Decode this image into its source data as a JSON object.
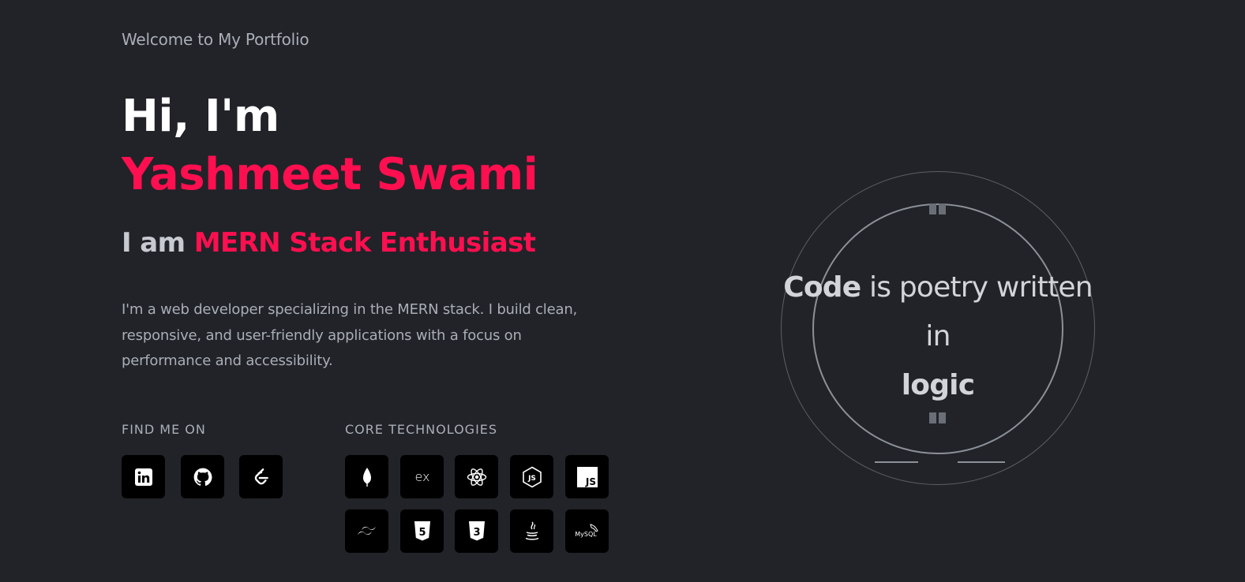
{
  "hero": {
    "welcome": "Welcome to My Portfolio",
    "greeting": "Hi, I'm",
    "name": "Yashmeet Swami",
    "role_prefix": "I am",
    "role": "MERN Stack Enthusiast",
    "bio": "I'm a web developer specializing in the MERN stack. I build clean, responsive, and user-friendly applications with a focus on performance and accessibility."
  },
  "social": {
    "label": "FIND ME ON",
    "items": [
      {
        "name": "linkedin-icon"
      },
      {
        "name": "github-icon"
      },
      {
        "name": "leetcode-icon"
      }
    ]
  },
  "tech": {
    "label": "CORE TECHNOLOGIES",
    "items": [
      {
        "name": "mongodb-icon"
      },
      {
        "name": "express-icon",
        "text": "ex"
      },
      {
        "name": "react-icon"
      },
      {
        "name": "nodejs-icon",
        "text": "JS"
      },
      {
        "name": "javascript-icon",
        "text": "JS"
      },
      {
        "name": "tailwind-icon"
      },
      {
        "name": "html5-icon",
        "text": "5"
      },
      {
        "name": "css3-icon",
        "text": "3"
      },
      {
        "name": "java-icon"
      },
      {
        "name": "mysql-icon",
        "text": "MySQL"
      }
    ]
  },
  "quote": {
    "word1": "Code",
    "middle": "is poetry written in",
    "word2": "logic"
  },
  "colors": {
    "background": "#212328",
    "accent": "#ff0f4f",
    "muted": "#a9aeb8",
    "tile": "#000000"
  }
}
